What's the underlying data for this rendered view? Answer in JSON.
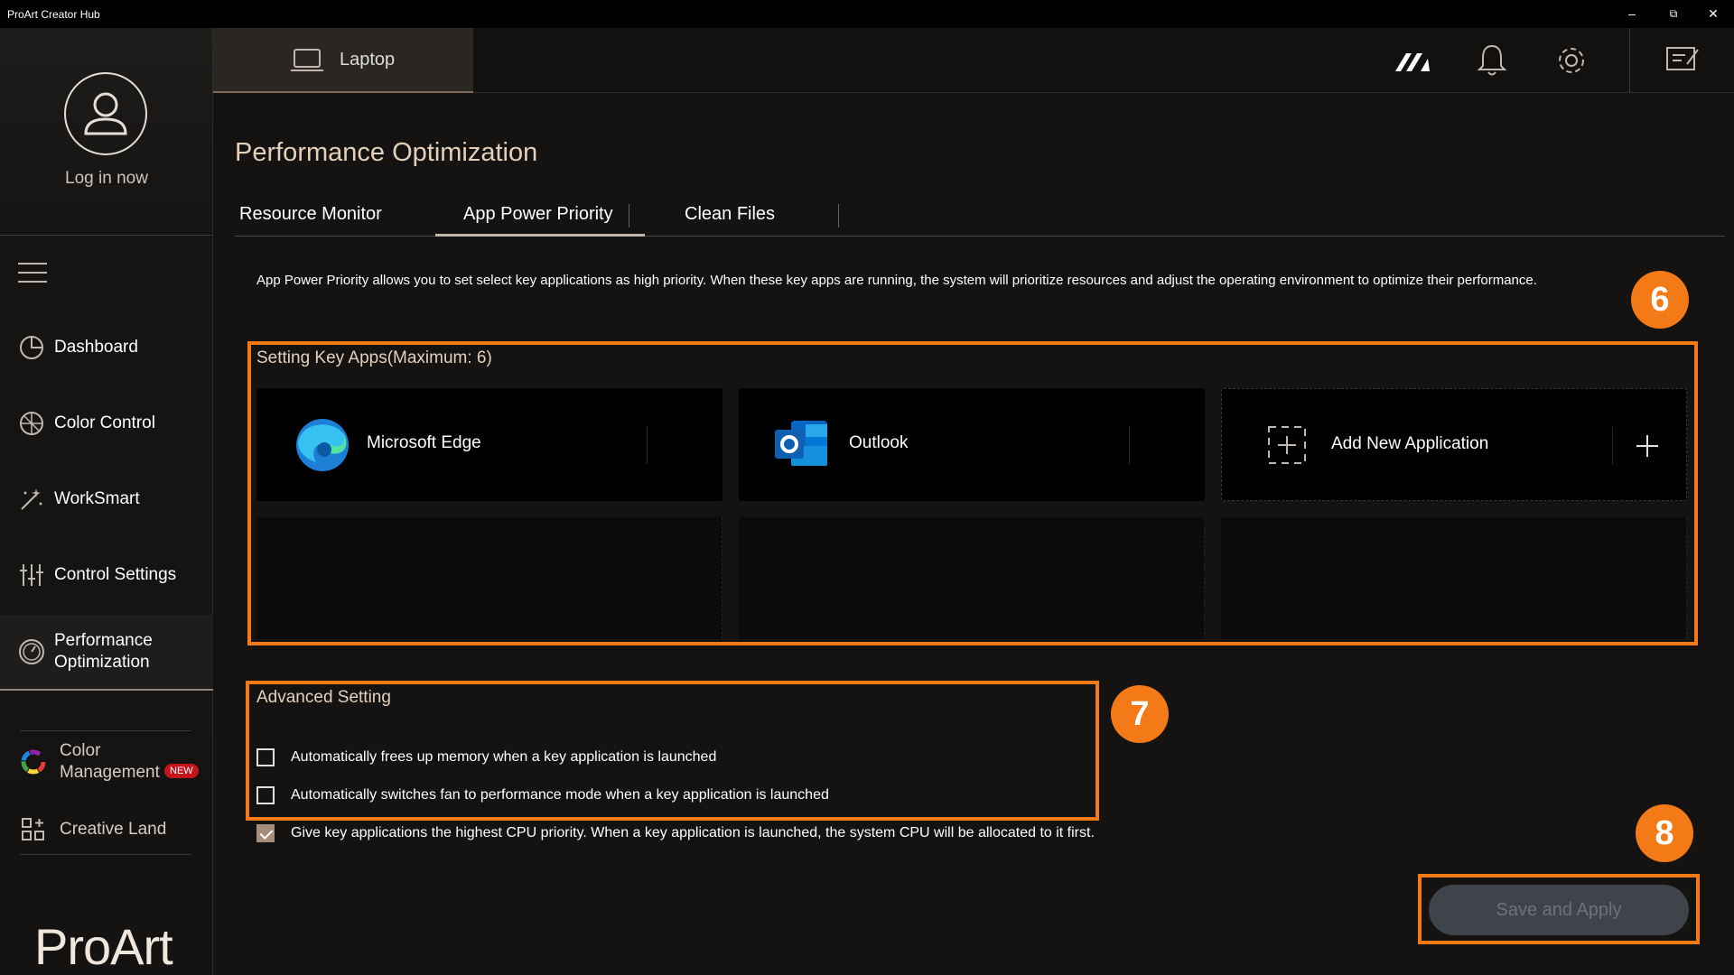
{
  "window": {
    "title": "ProArt Creator Hub",
    "minimize": "–",
    "restore": "⧉",
    "close": "✕"
  },
  "sidebar": {
    "login_label": "Log in now",
    "items": [
      {
        "label": "Dashboard",
        "icon": "dashboard-icon"
      },
      {
        "label": "Color Control",
        "icon": "color-control-icon"
      },
      {
        "label": "WorkSmart",
        "icon": "worksmart-icon"
      },
      {
        "label": "Control Settings",
        "icon": "control-settings-icon"
      },
      {
        "label": "Performance Optimization",
        "icon": "performance-icon",
        "active": true
      }
    ],
    "extras": [
      {
        "label": "Color Management",
        "icon": "color-wheel-icon",
        "badge": "NEW"
      },
      {
        "label": "Creative Land",
        "icon": "creative-land-icon"
      }
    ],
    "brand": "ProArt"
  },
  "header": {
    "device_label": "Laptop",
    "icons": [
      "asus-logo-icon",
      "bell-icon",
      "gear-icon",
      "feedback-icon"
    ]
  },
  "page": {
    "title": "Performance Optimization",
    "tabs": [
      {
        "label": "Resource Monitor"
      },
      {
        "label": "App Power Priority",
        "active": true
      },
      {
        "label": "Clean Files"
      }
    ],
    "description": "App Power Priority allows you to set select key applications as high priority. When these key apps are running, the system will prioritize resources and adjust the operating environment to optimize their performance.",
    "key_apps": {
      "label": "Setting Key Apps(Maximum: 6)",
      "apps": [
        {
          "name": "Microsoft Edge",
          "icon": "edge-icon"
        },
        {
          "name": "Outlook",
          "icon": "outlook-icon"
        }
      ],
      "add_label": "Add New Application"
    },
    "advanced": {
      "label": "Advanced Setting",
      "options": [
        {
          "label": "Automatically frees up memory when a key application is launched",
          "checked": false
        },
        {
          "label": "Automatically switches fan to performance mode when a key application is launched",
          "checked": false
        },
        {
          "label": "Give key applications the highest CPU priority. When a key application is launched, the system CPU will be allocated to it first.",
          "checked": true
        }
      ]
    },
    "save_label": "Save and Apply"
  },
  "callouts": {
    "six": "6",
    "seven": "7",
    "eight": "8"
  },
  "colors": {
    "callout": "#f37a17",
    "accent": "#e5d0bc",
    "badge": "#c4151c"
  }
}
